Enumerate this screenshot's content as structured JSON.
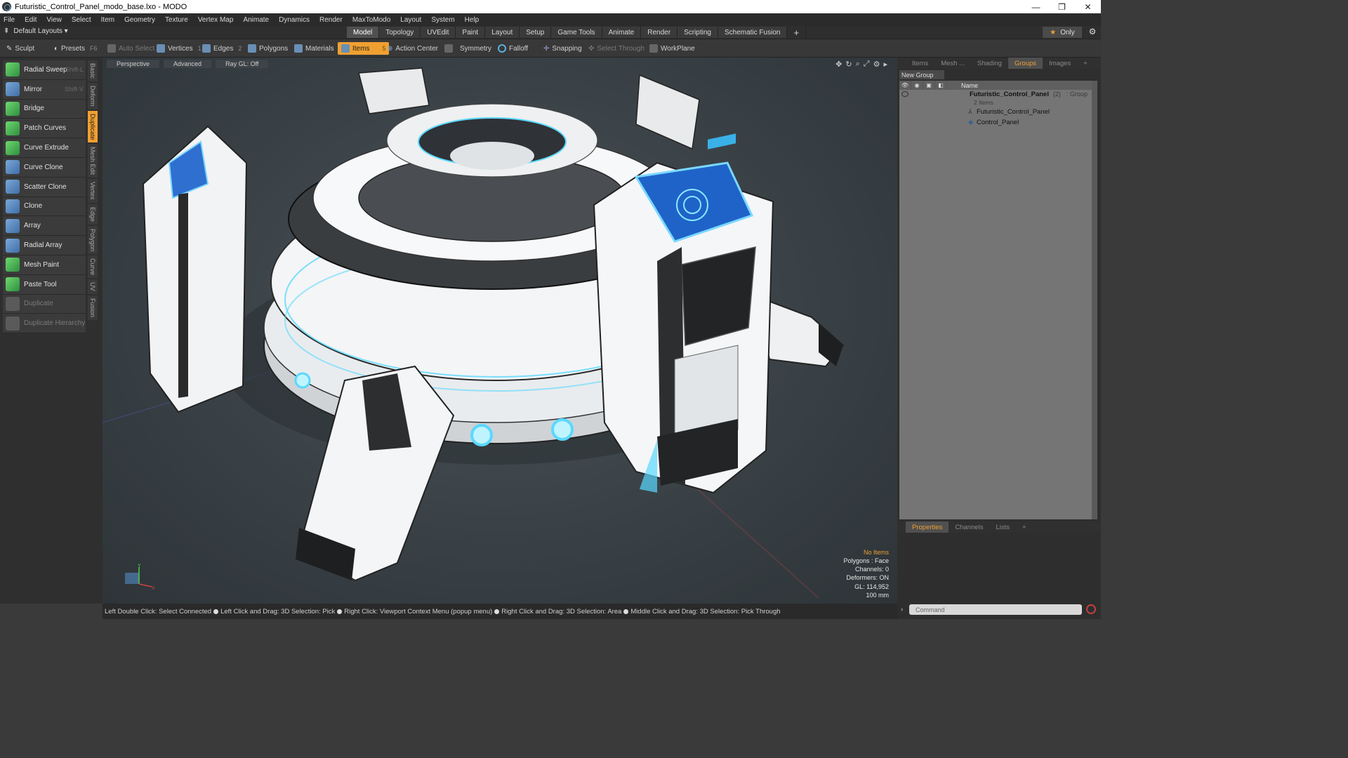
{
  "window": {
    "title": "Futuristic_Control_Panel_modo_base.lxo - MODO",
    "controls": [
      "—",
      "❐",
      "✕"
    ]
  },
  "menu": [
    "File",
    "Edit",
    "View",
    "Select",
    "Item",
    "Geometry",
    "Texture",
    "Vertex Map",
    "Animate",
    "Dynamics",
    "Render",
    "MaxToModo",
    "Layout",
    "System",
    "Help"
  ],
  "layout": {
    "selector": "Default Layouts ▾",
    "tabs": [
      "Model",
      "Topology",
      "UVEdit",
      "Paint",
      "Layout",
      "Setup",
      "Game Tools",
      "Animate",
      "Render",
      "Scripting",
      "Schematic Fusion"
    ],
    "active_tab": "Model",
    "add_tab": "+",
    "only_label": "Only"
  },
  "toolbar": {
    "sculpt": "Sculpt",
    "presets": "Presets",
    "presets_key": "F6",
    "auto_select": "Auto Select",
    "vertices": "Vertices",
    "vertices_count": "1",
    "edges": "Edges",
    "edges_count": "2",
    "polygons": "Polygons",
    "materials": "Materials",
    "items": "Items",
    "items_count": "5",
    "action_center": "Action Center",
    "symmetry": "Symmetry",
    "falloff": "Falloff",
    "snapping": "Snapping",
    "select_through": "Select Through",
    "workplane": "WorkPlane"
  },
  "tools": [
    {
      "label": "Radial Sweep",
      "key": "Shift-L",
      "enabled": true
    },
    {
      "label": "Mirror",
      "key": "Shift-V",
      "enabled": true
    },
    {
      "label": "Bridge",
      "key": "",
      "enabled": true
    },
    {
      "label": "Patch Curves",
      "key": "",
      "enabled": true
    },
    {
      "label": "Curve Extrude",
      "key": "",
      "enabled": true
    },
    {
      "label": "Curve Clone",
      "key": "",
      "enabled": true
    },
    {
      "label": "Scatter Clone",
      "key": "",
      "enabled": true
    },
    {
      "label": "Clone",
      "key": "",
      "enabled": true
    },
    {
      "label": "Array",
      "key": "",
      "enabled": true
    },
    {
      "label": "Radial Array",
      "key": "",
      "enabled": true
    },
    {
      "label": "Mesh Paint",
      "key": "",
      "enabled": true
    },
    {
      "label": "Paste Tool",
      "key": "",
      "enabled": true
    },
    {
      "label": "Duplicate",
      "key": "",
      "enabled": false
    },
    {
      "label": "Duplicate Hierarchy",
      "key": "",
      "enabled": false
    }
  ],
  "vertical_tabs": [
    "Basic",
    "Deform",
    "Duplicate",
    "Mesh Edit",
    "Vertex",
    "Edge",
    "Polygon",
    "Curve",
    "UV",
    "Fusion"
  ],
  "active_vertical_tab": "Duplicate",
  "viewport": {
    "view": "Perspective",
    "shading": "Advanced",
    "raygl": "Ray GL: Off",
    "stats": {
      "selection": "No Items",
      "polygons": "Polygons : Face",
      "channels": "Channels: 0",
      "deformers": "Deformers: ON",
      "gl": "GL: 114,952",
      "scale": "100 mm"
    }
  },
  "status": {
    "hints": [
      "Left Double Click: Select Connected",
      "Left Click and Drag: 3D Selection: Pick",
      "Right Click: Viewport Context Menu (popup menu)",
      "Right Click and Drag: 3D Selection: Area",
      "Middle Click and Drag: 3D Selection: Pick Through"
    ]
  },
  "right_panel": {
    "top_tabs": [
      "Items",
      "Mesh ...",
      "Shading",
      "Groups",
      "Images",
      "+"
    ],
    "active_top_tab": "Groups",
    "new_group": "New Group",
    "name_header": "Name",
    "group": {
      "name": "Futuristic_Control_Panel",
      "count": "(2)",
      "type": ": Group",
      "subtitle": "2 Items"
    },
    "children": [
      "Futuristic_Control_Panel",
      "Control_Panel"
    ],
    "bottom_tabs": [
      "Properties",
      "Channels",
      "Lists",
      "+"
    ],
    "active_bottom_tab": "Properties",
    "command_placeholder": "Command"
  },
  "colors": {
    "accent": "#f0a030",
    "viewport_bg": "#394146",
    "glow": "#5ad8ff"
  }
}
